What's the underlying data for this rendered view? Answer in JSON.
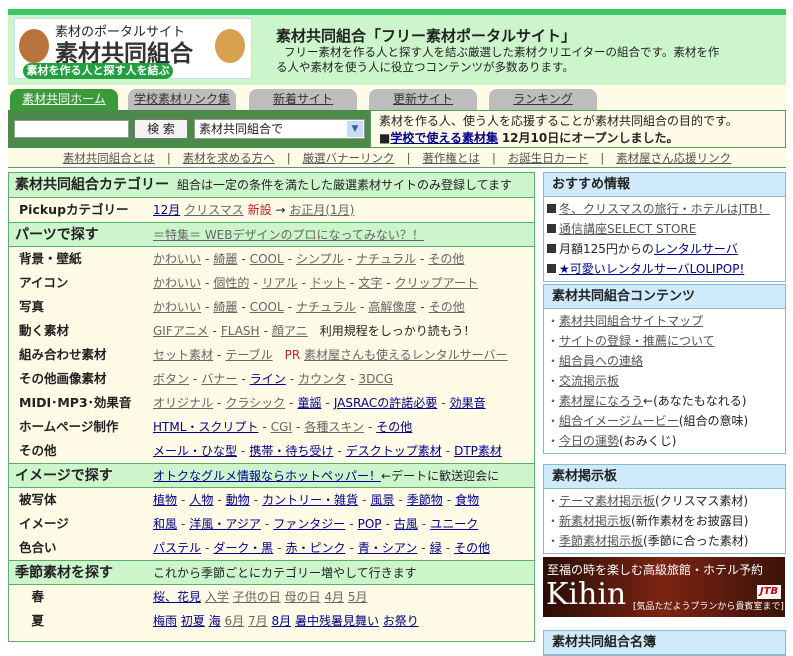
{
  "logo": {
    "line1": "素材のポータルサイト",
    "line2": "素材共同組合",
    "line3": "素材を作る人と探す人を結ぶ"
  },
  "header": {
    "title": "素材共同組合「フリー素材ポータルサイト」",
    "desc": "フリー素材を作る人と探す人を結ぶ厳選した素材クリエイターの組合です。素材を作る人や素材を使う人に役立つコンテンツが多数あります。"
  },
  "tabs": [
    "素材共同ホーム",
    "学校素材リンク集",
    "新着サイト",
    "更新サイト",
    "ランキング"
  ],
  "search": {
    "value": "",
    "button": "検 索",
    "select": "素材共同組合で"
  },
  "notice": {
    "line1": "素材を作る人、使う人を応援することが素材共同組合の目的です。",
    "bullet": "■",
    "link": "学校で使える素材集",
    "after": "12月10日にオープンしました。"
  },
  "nav": [
    "素材共同組合とは",
    "素材を求める方へ",
    "厳選バナーリンク",
    "著作権とは",
    "お誕生日カード",
    "素材屋さん応援リンク"
  ],
  "nav_sep": "|",
  "main": {
    "rows": [
      {
        "type": "head",
        "label": "素材共同組合カテゴリー",
        "items": [
          {
            "t": "組合は一定の条件を満たした厳選素材サイトのみ登録してます",
            "k": "text"
          }
        ]
      },
      {
        "type": "row",
        "label": "Pickupカテゴリー",
        "sep": " ",
        "items": [
          {
            "t": "12月",
            "k": "n"
          },
          {
            "t": "クリスマス",
            "k": "v"
          },
          {
            "t": "新設",
            "k": "red"
          },
          {
            "t": "→",
            "k": "text"
          },
          {
            "t": "お正月(1月)",
            "k": "v"
          }
        ]
      },
      {
        "type": "head",
        "label": "パーツで探す",
        "items": [
          {
            "t": "＝特集＝ WEBデザインのプロになってみない？！",
            "k": "v"
          }
        ]
      },
      {
        "type": "row",
        "label": "背景・壁紙",
        "items": [
          {
            "t": "かわいい",
            "k": "v"
          },
          {
            "t": "綺麗",
            "k": "v"
          },
          {
            "t": "COOL",
            "k": "v"
          },
          {
            "t": "シンプル",
            "k": "v"
          },
          {
            "t": "ナチュラル",
            "k": "v"
          },
          {
            "t": "その他",
            "k": "v"
          }
        ]
      },
      {
        "type": "row",
        "label": "アイコン",
        "items": [
          {
            "t": "かわいい",
            "k": "v"
          },
          {
            "t": "個性的",
            "k": "v"
          },
          {
            "t": "リアル",
            "k": "v"
          },
          {
            "t": "ドット",
            "k": "v"
          },
          {
            "t": "文字",
            "k": "v"
          },
          {
            "t": "クリップアート",
            "k": "v"
          }
        ]
      },
      {
        "type": "row",
        "label": "写真",
        "items": [
          {
            "t": "かわいい",
            "k": "v"
          },
          {
            "t": "綺麗",
            "k": "v"
          },
          {
            "t": "COOL",
            "k": "v"
          },
          {
            "t": "ナチュラル",
            "k": "v"
          },
          {
            "t": "高解像度",
            "k": "v"
          },
          {
            "t": "その他",
            "k": "v"
          }
        ]
      },
      {
        "type": "row",
        "label": "動く素材",
        "items": [
          {
            "t": "GIFアニメ",
            "k": "v"
          },
          {
            "t": "FLASH",
            "k": "v"
          },
          {
            "t": "顔アニ",
            "k": "v"
          },
          {
            "t": "　利用規程をしっかり読もう！",
            "k": "text"
          }
        ]
      },
      {
        "type": "row",
        "label": "組み合わせ素材",
        "items": [
          {
            "t": "セット素材",
            "k": "v"
          },
          {
            "t": "テーブル",
            "k": "v"
          },
          {
            "t": "　PR ",
            "k": "red"
          },
          {
            "t": "素材屋さんも使えるレンタルサーバー",
            "k": "v"
          }
        ]
      },
      {
        "type": "row",
        "label": "その他画像素材",
        "items": [
          {
            "t": "ボタン",
            "k": "v"
          },
          {
            "t": "バナー",
            "k": "v"
          },
          {
            "t": "ライン",
            "k": "n"
          },
          {
            "t": "カウンタ",
            "k": "v"
          },
          {
            "t": "3DCG",
            "k": "v"
          }
        ]
      },
      {
        "type": "row",
        "label": "MIDI･MP3･効果音",
        "items": [
          {
            "t": "オリジナル",
            "k": "v"
          },
          {
            "t": "クラシック",
            "k": "v"
          },
          {
            "t": "童謡",
            "k": "n"
          },
          {
            "t": "JASRACの許諾必要",
            "k": "n"
          },
          {
            "t": "効果音",
            "k": "n"
          }
        ]
      },
      {
        "type": "row",
        "label": "ホームページ制作",
        "items": [
          {
            "t": "HTML・スクリプト",
            "k": "n"
          },
          {
            "t": "CGI",
            "k": "v"
          },
          {
            "t": "各種スキン",
            "k": "v"
          },
          {
            "t": "その他",
            "k": "n"
          }
        ]
      },
      {
        "type": "row",
        "label": "その他",
        "items": [
          {
            "t": "メール・ひな型",
            "k": "n"
          },
          {
            "t": "携帯・待ち受け",
            "k": "n"
          },
          {
            "t": "デスクトップ素材",
            "k": "n"
          },
          {
            "t": "DTP素材",
            "k": "n"
          }
        ]
      },
      {
        "type": "head",
        "label": "イメージで探す",
        "items": [
          {
            "t": "オトクなグルメ情報ならホットペッパー！",
            "k": "n"
          },
          {
            "t": "←デートに歓送迎会に",
            "k": "text"
          }
        ]
      },
      {
        "type": "row",
        "label": "被写体",
        "items": [
          {
            "t": "植物",
            "k": "n"
          },
          {
            "t": "人物",
            "k": "n"
          },
          {
            "t": "動物",
            "k": "n"
          },
          {
            "t": "カントリー・雑貨",
            "k": "n"
          },
          {
            "t": "風景",
            "k": "n"
          },
          {
            "t": "季節物",
            "k": "n"
          },
          {
            "t": "食物",
            "k": "n"
          }
        ]
      },
      {
        "type": "row",
        "label": "イメージ",
        "items": [
          {
            "t": "和風",
            "k": "n"
          },
          {
            "t": "洋風・アジア",
            "k": "n"
          },
          {
            "t": "ファンタジー",
            "k": "n"
          },
          {
            "t": "POP",
            "k": "n"
          },
          {
            "t": "古風",
            "k": "n"
          },
          {
            "t": "ユニーク",
            "k": "n"
          }
        ]
      },
      {
        "type": "row",
        "label": "色合い",
        "items": [
          {
            "t": "パステル",
            "k": "n"
          },
          {
            "t": "ダーク・黒",
            "k": "n"
          },
          {
            "t": "赤・ピンク",
            "k": "n"
          },
          {
            "t": "青・シアン",
            "k": "n"
          },
          {
            "t": "緑",
            "k": "n"
          },
          {
            "t": "その他",
            "k": "n"
          }
        ]
      },
      {
        "type": "head",
        "label": "季節素材を探す",
        "items": [
          {
            "t": "これから季節ごとにカテゴリー増やして行きます",
            "k": "text"
          }
        ]
      },
      {
        "type": "row",
        "label": "　春",
        "sep": " ",
        "items": [
          {
            "t": "桜、花見",
            "k": "n"
          },
          {
            "t": "入学",
            "k": "v"
          },
          {
            "t": "子供の日",
            "k": "v"
          },
          {
            "t": "母の日",
            "k": "v"
          },
          {
            "t": "4月",
            "k": "v"
          },
          {
            "t": "5月",
            "k": "v"
          }
        ]
      },
      {
        "type": "row",
        "label": "　夏",
        "sep": " ",
        "items": [
          {
            "t": "梅雨",
            "k": "n"
          },
          {
            "t": "初夏",
            "k": "n"
          },
          {
            "t": "海",
            "k": "n"
          },
          {
            "t": "6月",
            "k": "v"
          },
          {
            "t": "7月",
            "k": "v"
          },
          {
            "t": "8月",
            "k": "n"
          },
          {
            "t": "暑中残暑見舞い",
            "k": "n"
          },
          {
            "t": "お祭り",
            "k": "n"
          }
        ]
      }
    ]
  },
  "sidebar": {
    "boxes": [
      {
        "title": "おすすめ情報",
        "bullet": "sq",
        "items": [
          {
            "link": "冬、クリスマスの旅行・ホテルはJTB！",
            "k": "v"
          },
          {
            "link": "通信講座SELECT STORE",
            "k": "v"
          },
          {
            "pre": "月額125円からの",
            "link": "レンタルサーバ",
            "k": "n"
          },
          {
            "link": "★可愛いレンタルサーバLOLIPOP!",
            "k": "n"
          }
        ]
      },
      {
        "title": "素材共同組合コンテンツ",
        "bullet": "・",
        "items": [
          {
            "link": "素材共同組合サイトマップ",
            "k": "v"
          },
          {
            "link": "サイトの登録・推薦について",
            "k": "v"
          },
          {
            "link": "組合員への連絡",
            "k": "v"
          },
          {
            "link": "交流掲示板",
            "k": "v"
          },
          {
            "link": "素材屋になろう",
            "post": "←(あなたもなれる)",
            "k": "v"
          },
          {
            "link": "組合イメージムービー",
            "post": "(組合の意味)",
            "k": "v"
          },
          {
            "link": "今日の運勢",
            "post": "(おみくじ)",
            "k": "v"
          }
        ]
      },
      {
        "title": "素材掲示板",
        "bullet": "・",
        "items": [
          {
            "link": "テーマ素材掲示板",
            "post": "(クリスマス素材)",
            "k": "v"
          },
          {
            "link": "新素材掲示板",
            "post": "(新作素材をお披露目)",
            "k": "v"
          },
          {
            "link": "季節素材掲示板",
            "post": "(季節に合った素材)",
            "k": "v"
          }
        ]
      },
      {
        "title": "素材共同組合名簿",
        "bullet": "・",
        "items": []
      }
    ],
    "banner": {
      "title": "至福の時を楽しむ高級旅館・ホテル予約",
      "brand": "Kihin",
      "sub": "[気品ただようプランから貴賓室まで]",
      "logo": "JTB"
    }
  }
}
